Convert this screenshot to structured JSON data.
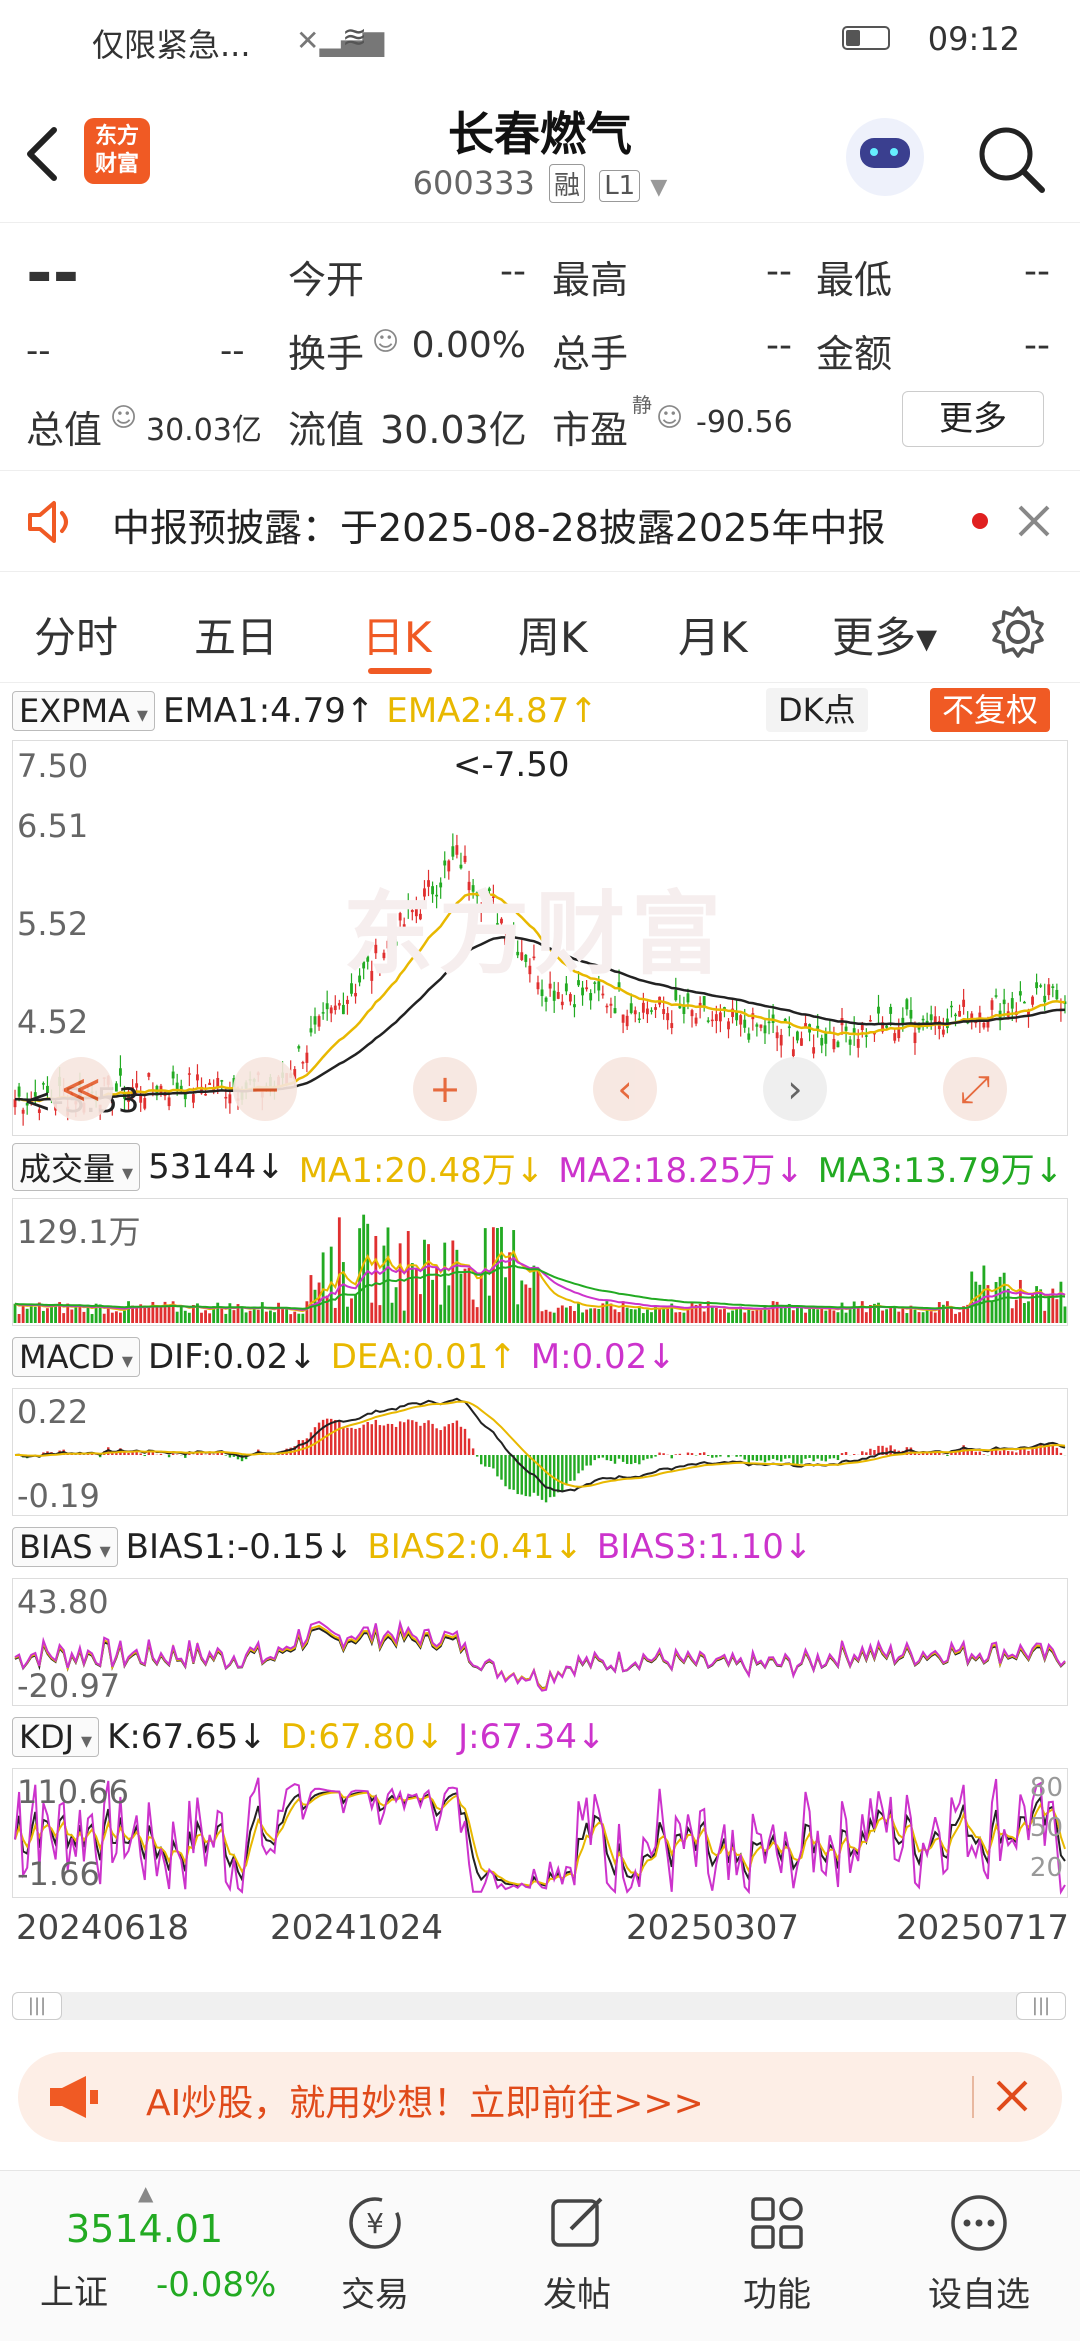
{
  "status_bar": {
    "carrier": "仅限紧急...",
    "time": "09:12"
  },
  "header": {
    "title": "长春燃气",
    "code": "600333",
    "tag_margin": "融",
    "tag_level": "L1",
    "logo_line1": "东方",
    "logo_line2": "财富"
  },
  "quote": {
    "price": "--",
    "change": "--",
    "change_pct": "--",
    "open_label": "今开",
    "open_value": "--",
    "high_label": "最高",
    "high_value": "--",
    "low_label": "最低",
    "low_value": "--",
    "turnover_label": "换手",
    "turnover_value": "0.00%",
    "volume_label": "总手",
    "volume_value": "--",
    "amount_label": "金额",
    "amount_value": "--",
    "mcap_label": "总值",
    "mcap_value": "30.03亿",
    "float_label": "流值",
    "float_value": "30.03亿",
    "pe_label": "市盈",
    "pe_sup": "静",
    "pe_value": "-90.56",
    "more_button": "更多"
  },
  "notice": {
    "text": "中报预披露：于2025-08-28披露2025年中报"
  },
  "tabs": [
    {
      "label": "分时"
    },
    {
      "label": "五日"
    },
    {
      "label": "日K"
    },
    {
      "label": "周K"
    },
    {
      "label": "月K"
    },
    {
      "label": "更多▾"
    }
  ],
  "kline": {
    "indicator": "EXPMA",
    "ema1": "EMA1:4.79↑",
    "ema2": "EMA2:4.87↑",
    "dk_button": "DK点",
    "fuquan_button": "不复权",
    "y_labels": [
      "7.50",
      "6.51",
      "5.52",
      "4.52"
    ],
    "max_label": "<-7.50",
    "min_label": "<-3.53",
    "watermark": "东方财富"
  },
  "volume": {
    "indicator": "成交量",
    "value": "53144↓",
    "ma1": "MA1:20.48万↓",
    "ma2": "MA2:18.25万↓",
    "ma3": "MA3:13.79万↓",
    "y_label": "129.1万"
  },
  "macd": {
    "indicator": "MACD",
    "dif": "DIF:0.02↓",
    "dea": "DEA:0.01↑",
    "m": "M:0.02↓",
    "y_top": "0.22",
    "y_bottom": "-0.19"
  },
  "bias": {
    "indicator": "BIAS",
    "bias1": "BIAS1:-0.15↓",
    "bias2": "BIAS2:0.41↓",
    "bias3": "BIAS3:1.10↓",
    "y_top": "43.80",
    "y_bottom": "-20.97"
  },
  "kdj": {
    "indicator": "KDJ",
    "k": "K:67.65↓",
    "d": "D:67.80↓",
    "j": "J:67.34↓",
    "y_top": "110.66",
    "y_bottom": "-1.66",
    "r80": "80",
    "r50": "50",
    "r20": "20"
  },
  "dates": [
    "20240618",
    "20241024",
    "20250307",
    "20250717"
  ],
  "ad": {
    "text": "AI炒股，就用妙想！立即前往>>>"
  },
  "bottom_nav": {
    "index_value": "3514.01",
    "index_name": "上证",
    "index_change": "-0.08%",
    "items": [
      {
        "label": "交易"
      },
      {
        "label": "发帖"
      },
      {
        "label": "功能"
      },
      {
        "label": "设自选"
      }
    ]
  },
  "colors": {
    "accent": "#f05a24",
    "up": "#e03030",
    "down": "#22aa22",
    "ema1": "#222222",
    "ema2": "#e8b800",
    "ma3": "#22aa22",
    "magenta": "#cc33cc"
  }
}
